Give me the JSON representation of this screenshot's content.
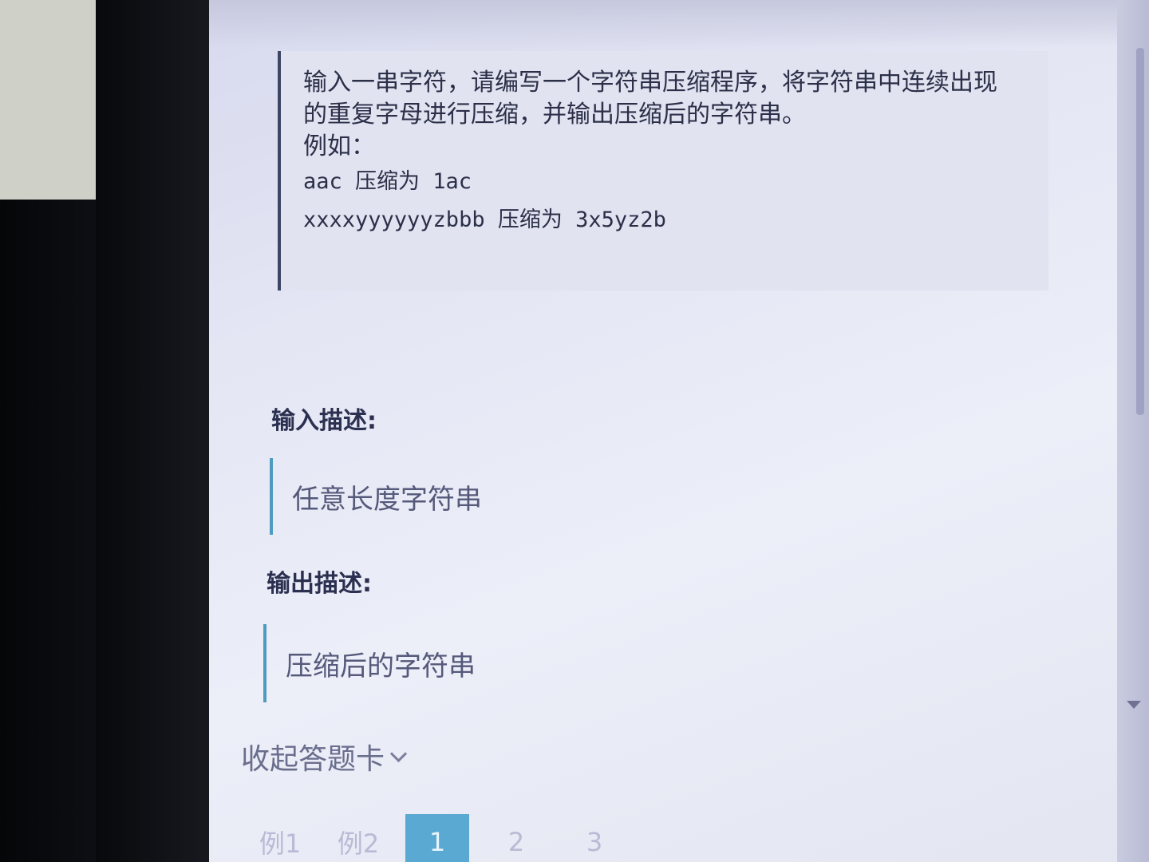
{
  "problem": {
    "lines": [
      "输入一串字符，请编写一个字符串压缩程序，将字符串中连续出现",
      "的重复字母进行压缩，并输出压缩后的字符串。",
      "例如："
    ],
    "examples": [
      "aac 压缩为 1ac",
      "xxxxyyyyyyzbbb 压缩为 3x5yz2b"
    ]
  },
  "input_section": {
    "title": "输入描述:",
    "content": "任意长度字符串"
  },
  "output_section": {
    "title": "输出描述:",
    "content": "压缩后的字符串"
  },
  "answer_card": {
    "toggle_label": "收起答题卡",
    "tabs": [
      "例1",
      "例2",
      "1",
      "2",
      "3"
    ],
    "active_tab": "1"
  },
  "colors": {
    "accent": "#5aa9d2",
    "quote_border": "#3c4662",
    "desc_border": "#4f9bc0"
  }
}
